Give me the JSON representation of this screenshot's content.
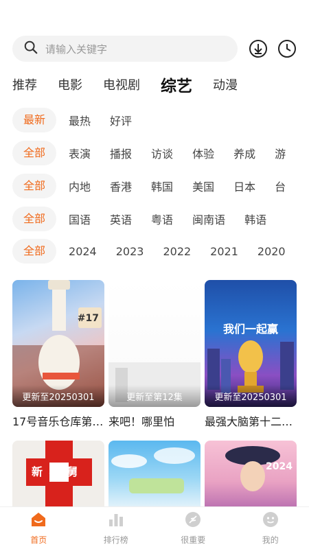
{
  "search": {
    "placeholder": "请输入关键字"
  },
  "tabs": [
    {
      "label": "推荐",
      "active": false
    },
    {
      "label": "电影",
      "active": false
    },
    {
      "label": "电视剧",
      "active": false
    },
    {
      "label": "综艺",
      "active": true
    },
    {
      "label": "动漫",
      "active": false
    }
  ],
  "filters": {
    "sort": {
      "selected": "最新",
      "options": [
        "最热",
        "好评"
      ]
    },
    "type": {
      "selected": "全部",
      "options": [
        "表演",
        "播报",
        "访谈",
        "体验",
        "养成",
        "游"
      ]
    },
    "region": {
      "selected": "全部",
      "options": [
        "内地",
        "香港",
        "韩国",
        "美国",
        "日本",
        "台"
      ]
    },
    "language": {
      "selected": "全部",
      "options": [
        "国语",
        "英语",
        "粤语",
        "闽南语",
        "韩语"
      ]
    },
    "year": {
      "selected": "全部",
      "options": [
        "2024",
        "2023",
        "2022",
        "2021",
        "2020"
      ]
    }
  },
  "cards": [
    {
      "title": "17号音乐仓库第…",
      "update": "更新至20250301",
      "poster_text": "#17"
    },
    {
      "title": "来吧！哪里怕",
      "update": "更新至第12集",
      "poster_text": ""
    },
    {
      "title": "最强大脑第十二…",
      "update": "更新至20250301",
      "poster_text": "我们一起赢"
    },
    {
      "title": "",
      "update": "",
      "poster_text": "新 老 舅"
    },
    {
      "title": "",
      "update": "",
      "poster_text": ""
    },
    {
      "title": "",
      "update": "",
      "poster_text": "2024"
    }
  ],
  "bottom_nav": [
    {
      "label": "首页",
      "icon": "home-icon",
      "active": true
    },
    {
      "label": "排行榜",
      "icon": "bar-chart-icon",
      "active": false
    },
    {
      "label": "很重要",
      "icon": "feather-icon",
      "active": false
    },
    {
      "label": "我的",
      "icon": "profile-icon",
      "active": false
    }
  ],
  "colors": {
    "accent": "#f06a1c",
    "chip_bg": "#f4f4f4",
    "search_bg": "#f3f3f3"
  }
}
